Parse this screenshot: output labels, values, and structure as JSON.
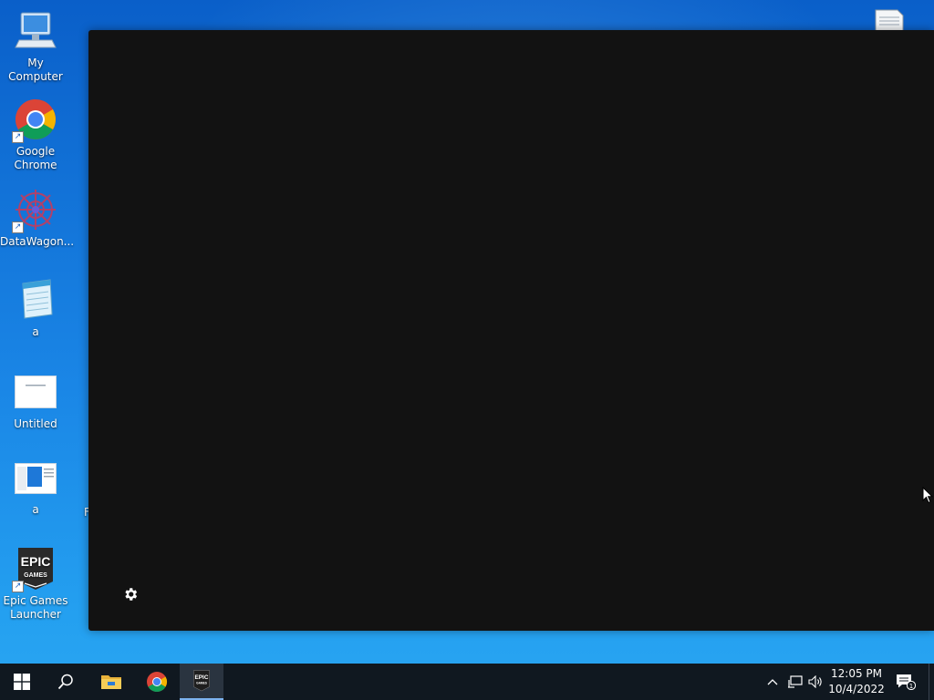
{
  "desktop": {
    "icons": [
      {
        "label": "My Computer",
        "icon": "computer-icon"
      },
      {
        "label": "Google\nChrome",
        "label_line1": "Google",
        "label_line2": "Chrome",
        "icon": "chrome-icon"
      },
      {
        "label": "DataWagon...",
        "icon": "datawagon-icon"
      },
      {
        "label": "a",
        "icon": "notepad-icon"
      },
      {
        "label": "Untitled",
        "icon": "document-thumbnail-icon"
      },
      {
        "label": "a",
        "icon": "window-thumbnail-icon"
      },
      {
        "label_line1": "Epic Games",
        "label_line2": "Launcher",
        "icon": "epic-games-icon"
      }
    ],
    "partial_letter": "F"
  },
  "app_window": {
    "background": "#121212",
    "settings_icon": "gear-icon"
  },
  "taskbar": {
    "start_icon": "windows-logo-icon",
    "search_icon": "search-icon",
    "pinned": [
      "file-explorer-icon",
      "chrome-icon",
      "epic-games-icon"
    ],
    "active_app": "Epic Games Launcher",
    "tray": {
      "chevron": "chevron-up-icon",
      "network": "network-icon",
      "volume": "volume-icon"
    },
    "time": "12:05 PM",
    "date": "10/4/2022",
    "notifications_count": "1"
  }
}
